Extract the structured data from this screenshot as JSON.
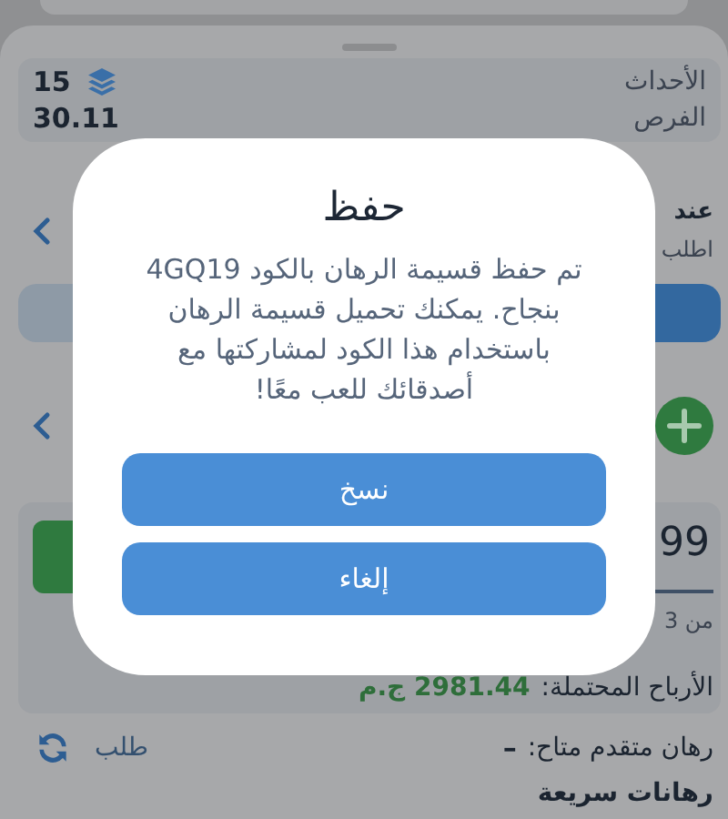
{
  "summary": [
    {
      "kind": "count",
      "label": "الأحداث",
      "value": "15"
    },
    {
      "kind": "odds",
      "label": "الفرص",
      "value": "30.11"
    }
  ],
  "odds_change": {
    "title": "عند",
    "subtitle": "اطلب"
  },
  "mode_toggle": [
    {
      "selected": false
    },
    {
      "selected": true
    }
  ],
  "stake": {
    "value": "99",
    "caption": "من 3",
    "winnings_label": "الأرباح المحتملة:",
    "winnings_value": "2981.44 ج.م"
  },
  "advanced": {
    "label": "رهان متقدم متاح:",
    "value": "–",
    "action": "طلب"
  },
  "section_title": "رهانات سريعة",
  "dialog": {
    "title": "حفظ",
    "message": "تم حفظ قسيمة الرهان بالكود 4GQ19 بنجاح. يمكنك تحميل قسيمة الرهان باستخدام هذا الكود لمشاركتها مع أصدقائك للعب معًا!",
    "buttons": [
      "نسخ",
      "إلغاء"
    ]
  }
}
